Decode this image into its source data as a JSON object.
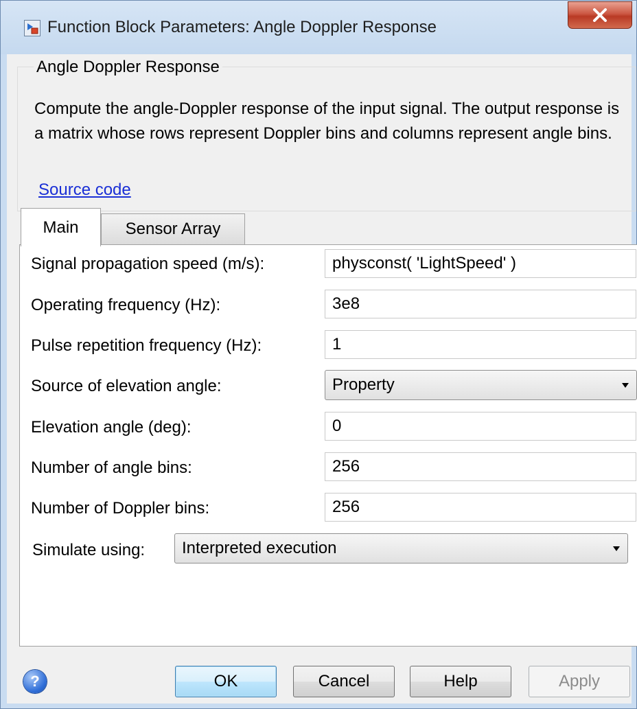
{
  "window": {
    "title": "Function Block Parameters: Angle Doppler Response",
    "close_glyph": "X"
  },
  "description": {
    "group_title": "Angle Doppler Response",
    "text": "Compute the angle-Doppler response of the input signal. The output response is a matrix whose rows represent Doppler bins and columns represent angle bins.",
    "link": "Source code"
  },
  "tabs": [
    {
      "label": "Main",
      "selected": true
    },
    {
      "label": "Sensor Array",
      "selected": false
    }
  ],
  "params": {
    "speed": {
      "label": "Signal propagation speed (m/s):",
      "value": "physconst( 'LightSpeed' )"
    },
    "frequency": {
      "label": "Operating frequency (Hz):",
      "value": "3e8"
    },
    "prf": {
      "label": "Pulse repetition frequency (Hz):",
      "value": "1"
    },
    "elev_source": {
      "label": "Source of elevation angle:",
      "value": "Property"
    },
    "elevation": {
      "label": "Elevation angle (deg):",
      "value": "0"
    },
    "angle_bins": {
      "label": "Number of angle bins:",
      "value": "256"
    },
    "doppler_bins": {
      "label": "Number of Doppler bins:",
      "value": "256"
    },
    "simulate": {
      "label": "Simulate using:",
      "value": "Interpreted execution"
    }
  },
  "buttons": {
    "help_icon": "?",
    "ok": "OK",
    "cancel": "Cancel",
    "help": "Help",
    "apply": "Apply"
  },
  "colors": {
    "window_frame": "#c9dcf1",
    "client_bg": "#f0f0f0",
    "link": "#1a2fd6",
    "close_button": "#c7533e"
  }
}
